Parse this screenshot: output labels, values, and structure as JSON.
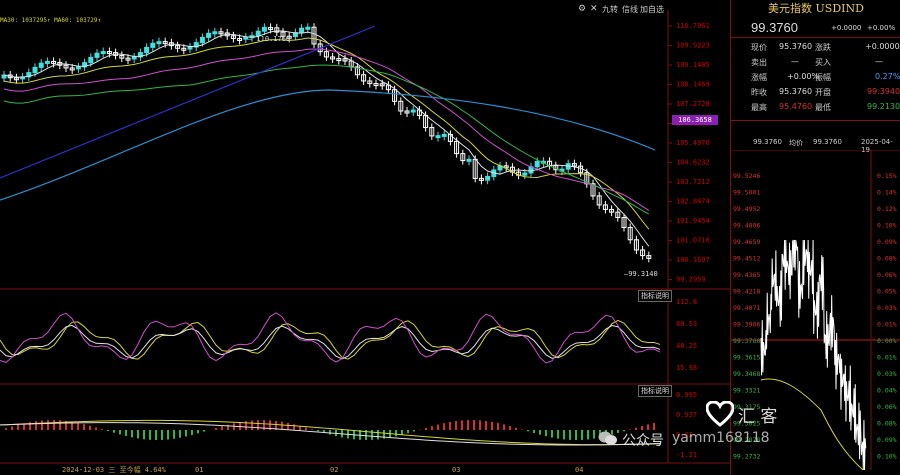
{
  "toolbar": {
    "btn1": "九转",
    "btn2": "信线",
    "btn3": "加自选",
    "gear_icon": "gear-icon",
    "close_icon": "close-icon"
  },
  "ma_text": "MA30:  1037295↑  MA60: 103729↑",
  "main_chart": {
    "price_ticks": [
      "110.7961",
      "109.9223",
      "109.1485",
      "108.1465",
      "107.2728",
      "106.3990",
      "105.4970",
      "104.6232",
      "103.7212",
      "102.8474",
      "101.9454",
      "101.0716",
      "100.1697",
      "99.2959"
    ],
    "current_price_badge": "106.3658",
    "high_label": "110.1760",
    "low_label": "99.3140",
    "colors": {
      "up": "#40e0e0",
      "down": "#ffffff",
      "ma_white": "#e0e0e0",
      "ma_yellow": "#d6d630",
      "ma_pink": "#d050d0",
      "ma_green": "#2fb84a",
      "ma_blue": "#2a8fd0",
      "trend": "#3030d0"
    }
  },
  "indicator1": {
    "label": "指标说明",
    "ticks": [
      "112.8",
      "80.53",
      "48.25",
      "15.98"
    ]
  },
  "indicator2": {
    "label": "指标说明",
    "ticks": [
      "0.995",
      "0.937",
      "0.32",
      "-1.21"
    ]
  },
  "dates": {
    "first": "2024-12-03 三 至今幅 4.64%",
    "d1": "01",
    "d2": "02",
    "d3": "03",
    "d4": "04"
  },
  "quote": {
    "title": "美元指数 USDIND",
    "price": "99.3760",
    "change": "+0.0000",
    "pct": "+0.00%",
    "rows": [
      {
        "l1": "现价",
        "v1": "95.3760",
        "l2": "涨跌",
        "v2": "+0.0000"
      },
      {
        "l1": "卖出",
        "v1": "—",
        "l2": "买入",
        "v2": "—"
      },
      {
        "l1": "涨幅",
        "v1": "+0.00%",
        "l2": "振幅",
        "v2": "0.27%"
      },
      {
        "l1": "昨收",
        "v1": "95.3760",
        "l2": "开盘",
        "v2": "99.3940"
      },
      {
        "l1": "最高",
        "v1": "95.4760",
        "l2": "最低",
        "v2": "99.2130"
      }
    ]
  },
  "intraday": {
    "head_price": "99.3760",
    "head_label": "均价",
    "head_avg": "99.3760",
    "head_date": "2025-04-19",
    "left_ticks": [
      "99.5246",
      "99.5001",
      "99.4952",
      "99.4806",
      "99.4659",
      "99.4512",
      "99.4365",
      "99.4218",
      "99.4071",
      "99.3906",
      "99.3760",
      "99.3615",
      "99.3468",
      "99.3321",
      "99.3175",
      "99.3025",
      "99.2878",
      "99.2732"
    ],
    "right_ticks": [
      "0.15%",
      "0.14%",
      "0.12%",
      "0.10%",
      "0.09%",
      "0.08%",
      "0.06%",
      "0.05%",
      "0.03%",
      "0.01%",
      "0.00%",
      "0.01%",
      "0.03%",
      "0.04%",
      "0.06%",
      "0.08%",
      "0.09%",
      "0.10%"
    ]
  },
  "watermark": {
    "brand": "汇 客",
    "wechat": "公众号",
    "id": "yamm168118"
  }
}
